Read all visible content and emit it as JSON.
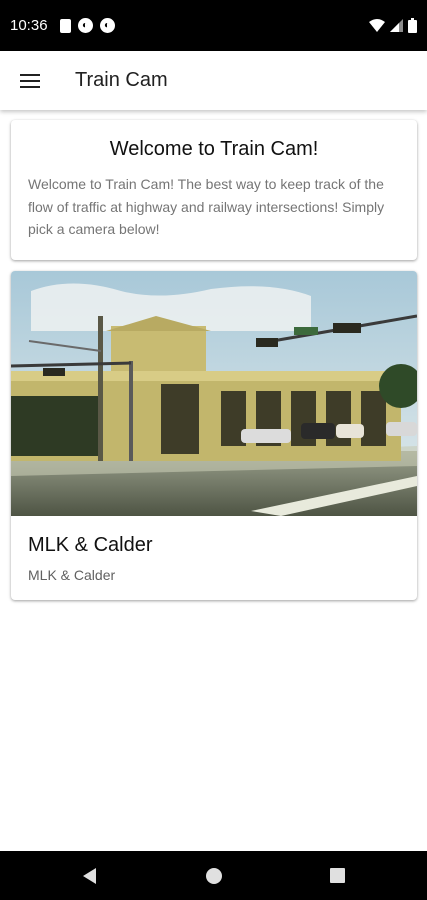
{
  "status_bar": {
    "time": "10:36",
    "left_icons": [
      "sd-card-icon",
      "notification-app-icon",
      "notification-app-icon"
    ],
    "right_icons": [
      "wifi-icon",
      "cellular-signal-icon",
      "battery-icon"
    ]
  },
  "app_bar": {
    "title": "Train Cam",
    "menu_icon": "hamburger-menu-icon"
  },
  "welcome_card": {
    "title": "Welcome to Train Cam!",
    "body": "Welcome to Train Cam! The best way to keep track of the flow of traffic at highway and railway intersections! Simply pick a camera below!"
  },
  "cameras": [
    {
      "title": "MLK & Calder",
      "subtitle": "MLK & Calder",
      "image": "intersection-photo"
    }
  ],
  "nav_bar": {
    "buttons": [
      "back-icon",
      "home-icon",
      "recents-icon"
    ]
  },
  "colors": {
    "status_bar_bg": "#000000",
    "app_bar_bg": "#ffffff",
    "card_bg": "#ffffff",
    "body_text": "#757575",
    "title_text": "#212121"
  }
}
